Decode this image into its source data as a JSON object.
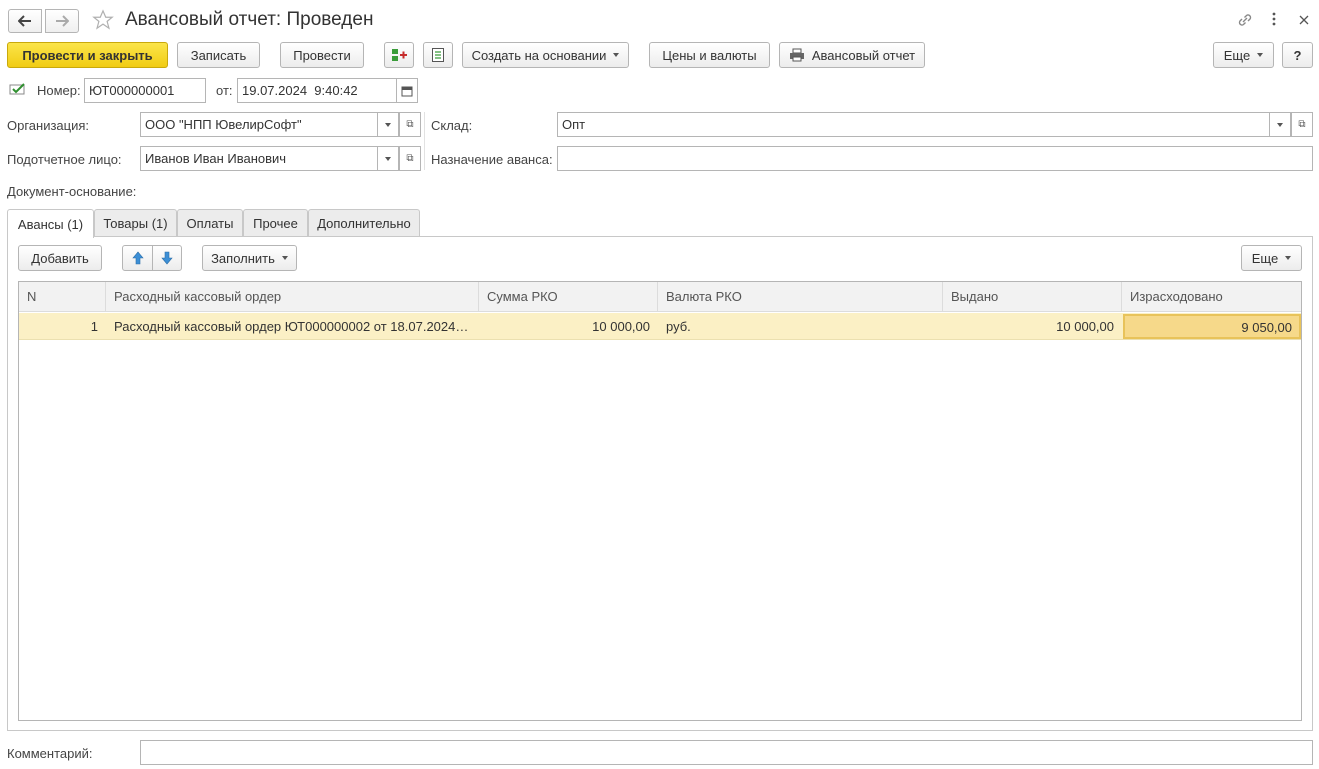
{
  "window": {
    "title": "Авансовый отчет: Проведен"
  },
  "icons": {
    "back": "arrow-left-icon",
    "forward": "arrow-right-icon",
    "favorite": "star-icon",
    "link": "link-icon",
    "more": "more-vertical-icon",
    "close": "close-icon"
  },
  "toolbar": {
    "post_and_close": "Провести и закрыть",
    "write": "Записать",
    "post": "Провести",
    "create_based_on": "Создать на основании",
    "prices_currencies": "Цены и валюты",
    "advance_report": "Авансовый отчет",
    "more": "Еще",
    "help": "?"
  },
  "header": {
    "number_label": "Номер:",
    "number_value": "ЮТ000000001",
    "date_label": "от:",
    "date_value": "19.07.2024  9:40:42",
    "organization_label": "Организация:",
    "organization_value": "ООО \"НПП ЮвелирСофт\"",
    "warehouse_label": "Склад:",
    "warehouse_value": "Опт",
    "accountable_label": "Подотчетное лицо:",
    "accountable_value": "Иванов Иван Иванович",
    "purpose_label": "Назначение аванса:",
    "purpose_value": "",
    "basis_label": "Документ-основание:"
  },
  "tabs": [
    {
      "label": "Авансы (1)",
      "active": true
    },
    {
      "label": "Товары (1)",
      "active": false
    },
    {
      "label": "Оплаты",
      "active": false
    },
    {
      "label": "Прочее",
      "active": false
    },
    {
      "label": "Дополнительно",
      "active": false
    }
  ],
  "table_toolbar": {
    "add": "Добавить",
    "fill": "Заполнить",
    "more": "Еще"
  },
  "table": {
    "columns": [
      "N",
      "Расходный кассовый ордер",
      "Сумма РКО",
      "Валюта РКО",
      "Выдано",
      "Израсходовано"
    ],
    "rows": [
      {
        "n": "1",
        "order": "Расходный кассовый ордер ЮТ000000002 от 18.07.2024 …",
        "amount": "10 000,00",
        "currency": "руб.",
        "issued": "10 000,00",
        "spent": "9 050,00"
      }
    ]
  },
  "footer": {
    "comment_label": "Комментарий:",
    "comment_value": ""
  },
  "colors": {
    "primary_button": "#f1cc14",
    "selected_row": "#fbf0c5",
    "active_cell_border": "#e8c35a"
  }
}
